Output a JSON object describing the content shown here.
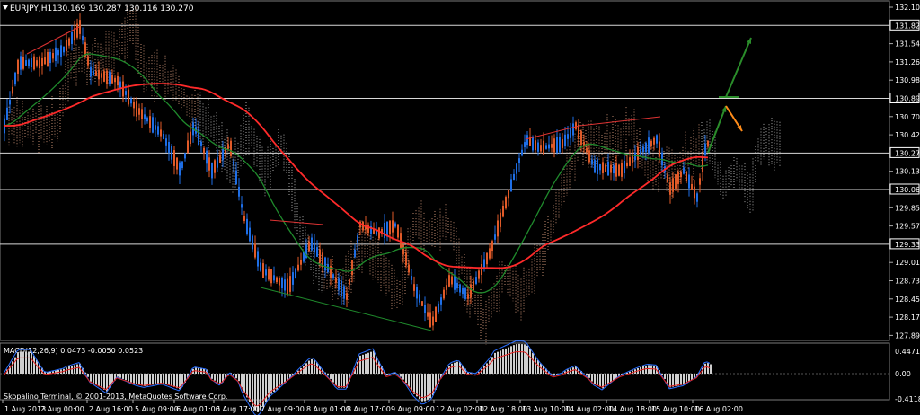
{
  "header": {
    "symbol": "EURJPY,H1",
    "ohlc": "130.169 130.287 130.116 130.270"
  },
  "price_axis": {
    "ticks": [
      "132.105",
      "131.821",
      "131.540",
      "131.260",
      "130.980",
      "130.897",
      "130.700",
      "130.420",
      "130.270",
      "130.135",
      "130.062",
      "129.855",
      "129.575",
      "129.337",
      "129.015",
      "128.730",
      "128.450",
      "128.170",
      "127.890"
    ],
    "highlighted": [
      "131.821",
      "130.897",
      "130.270",
      "130.062",
      "129.337"
    ]
  },
  "time_axis": {
    "labels": [
      "1 Aug 2013",
      "2 Aug 00:00",
      "2 Aug 16:00",
      "5 Aug 09:00",
      "6 Aug 01:00",
      "6 Aug 17:00",
      "7 Aug 09:00",
      "8 Aug 01:00",
      "8 Aug 17:00",
      "9 Aug 09:00",
      "12 Aug 02:00",
      "12 Aug 18:00",
      "13 Aug 10:00",
      "14 Aug 02:00",
      "14 Aug 18:00",
      "15 Aug 10:00",
      "16 Aug 02:00"
    ]
  },
  "macd": {
    "label": "MACD(12,26,9) 0.0473 -0.0050 0.0523",
    "ticks": [
      "0.4471",
      "0.00",
      "-0.4118"
    ]
  },
  "footer": {
    "copyright": "Skopalino Terminal, © 2001-2013, MetaQuotes Software Corp."
  },
  "colors": {
    "bull": "#1e6ee6",
    "bear": "#e05a28",
    "ma_fast": "#1f8a2c",
    "ma_slow": "#ff2a2a",
    "cloud_a": "#e0a080",
    "cloud_b": "#c8c8c8",
    "target_arrow": "#2a8c2a",
    "alt_arrow": "#ff8c1a"
  }
}
